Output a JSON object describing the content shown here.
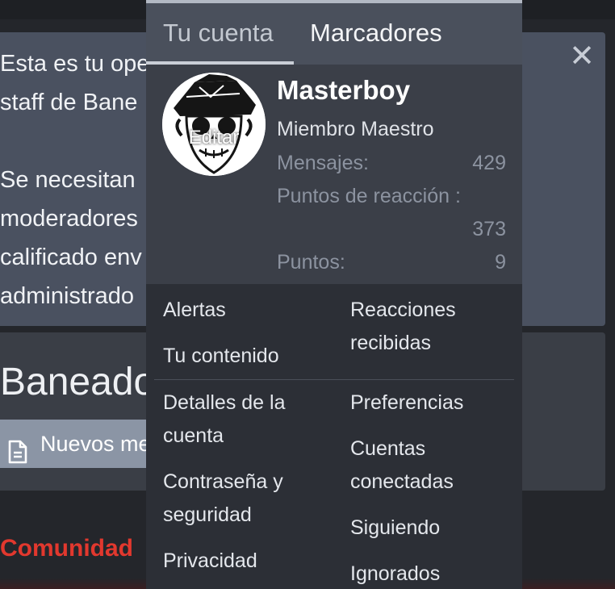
{
  "background": {
    "notice_lines": [
      "Esta es tu ope",
      "staff de Bane",
      "",
      "Se necesitan",
      "moderadores",
      "calificado env",
      "administrado"
    ],
    "heading": "Baneado",
    "new_button_label": "Nuevos me",
    "community_label": "Comunidad",
    "close_symbol": "✕"
  },
  "menu": {
    "tabs": {
      "account": "Tu cuenta",
      "bookmarks": "Marcadores"
    },
    "profile": {
      "edit_label": "Editar",
      "username": "Masterboy",
      "role": "Miembro Maestro",
      "messages_label": "Mensajes:",
      "messages_value": "429",
      "reaction_points_label": "Puntos de reacción :",
      "reaction_points_value": "373",
      "points_label": "Puntos:",
      "points_value": "9"
    },
    "links": {
      "alerts": "Alertas",
      "reactions_received": "Reacciones recibidas",
      "your_content": "Tu contenido",
      "account_details": "Detalles de la cuenta",
      "preferences": "Preferencias",
      "connected_accounts": "Cuentas conectadas",
      "password_security": "Contraseña y seguridad",
      "following": "Siguiendo",
      "privacy": "Privacidad",
      "ignoring": "Ignorados"
    }
  },
  "icons": {
    "close": "close-icon",
    "document": "document-icon",
    "avatar": "skull-cap-avatar"
  },
  "colors": {
    "accent_red": "#e2382e",
    "menu_bg": "#2c2f36",
    "profile_bg": "#3b3f48",
    "tab_bg": "#4a505c"
  }
}
